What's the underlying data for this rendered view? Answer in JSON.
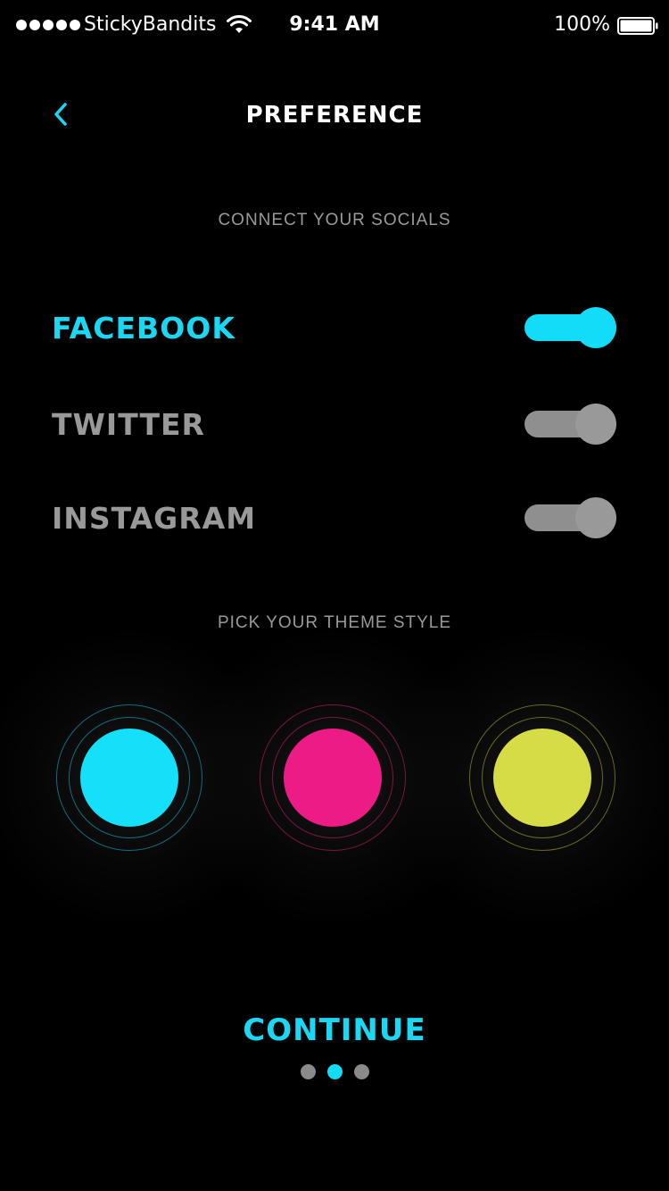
{
  "status_bar": {
    "carrier": "StickyBandits",
    "signal_icon": "signal-dots-icon",
    "wifi_icon": "wifi-icon",
    "time": "9:41 AM",
    "battery_percent": "100%",
    "battery_icon": "battery-icon",
    "battery_level": 1.0
  },
  "header": {
    "back_icon": "chevron-left-icon",
    "title": "PREFERENCE"
  },
  "socials": {
    "heading": "CONNECT YOUR SOCIALS",
    "items": [
      {
        "label": "FACEBOOK",
        "enabled": true
      },
      {
        "label": "TWITTER",
        "enabled": false
      },
      {
        "label": "INSTAGRAM",
        "enabled": false
      }
    ]
  },
  "theme": {
    "heading": "PICK YOUR THEME STYLE",
    "options": [
      {
        "color": "#14e0fa"
      },
      {
        "color": "#ec1b85"
      },
      {
        "color": "#d5dc45"
      }
    ]
  },
  "footer": {
    "continue_label": "CONTINUE",
    "page_count": 3,
    "current_page": 2
  },
  "colors": {
    "accent": "#1ad7f4",
    "inactive": "#999999",
    "background": "#000000"
  }
}
